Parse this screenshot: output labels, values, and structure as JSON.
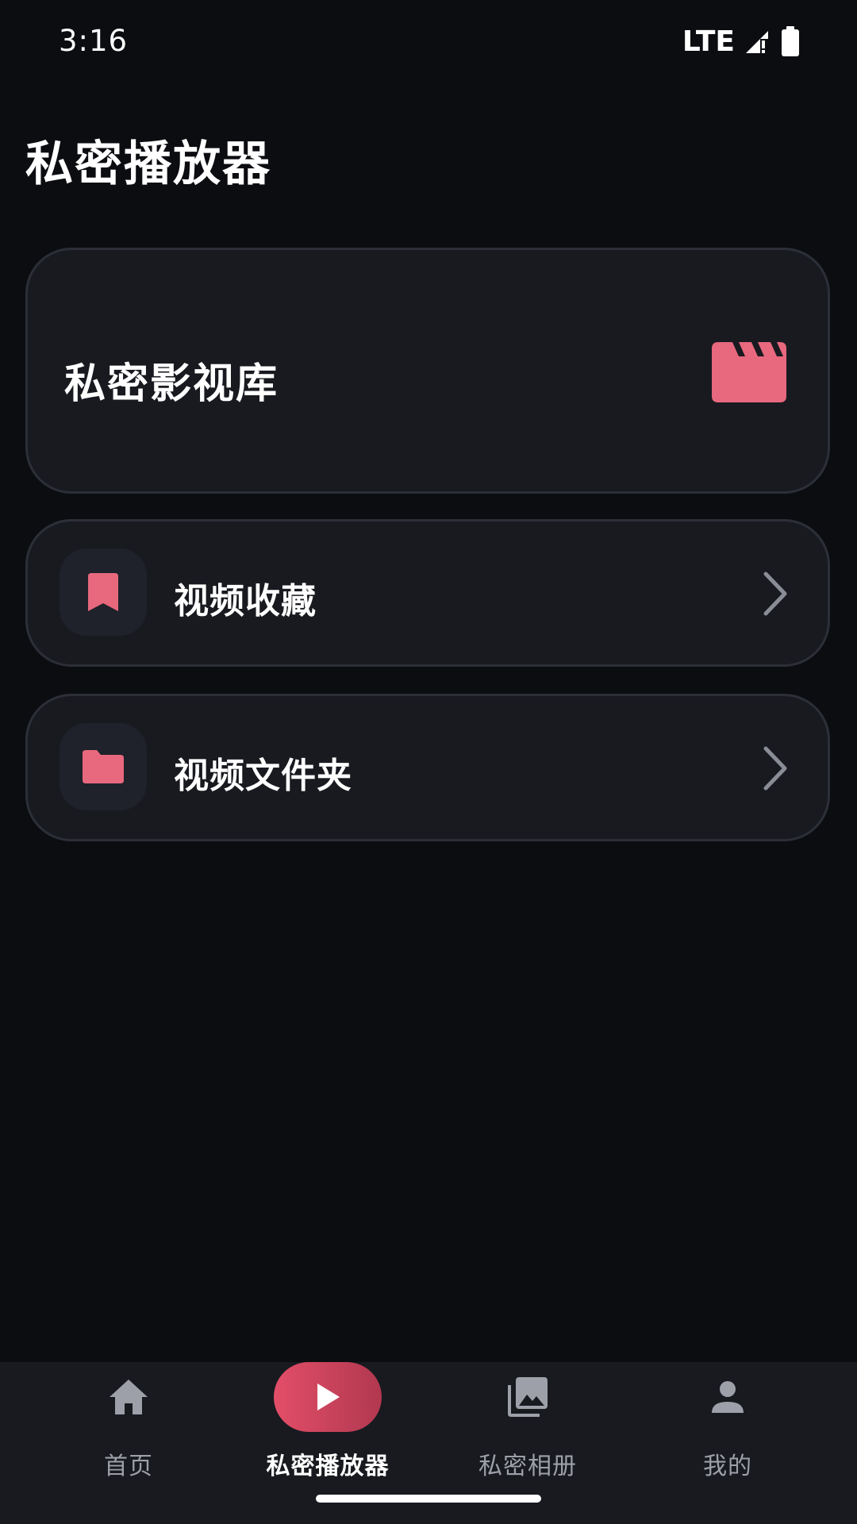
{
  "status_bar": {
    "time": "3:16",
    "network": "LTE",
    "icons": [
      "signal-icon",
      "battery-icon"
    ]
  },
  "page": {
    "title": "私密播放器"
  },
  "library_card": {
    "label": "私密影视库",
    "icon": "clapperboard-icon"
  },
  "menu": [
    {
      "label": "视频收藏",
      "icon": "bookmark-icon"
    },
    {
      "label": "视频文件夹",
      "icon": "folder-icon"
    }
  ],
  "bottom_nav": {
    "items": [
      {
        "label": "首页",
        "icon": "home-icon",
        "active": false
      },
      {
        "label": "私密播放器",
        "icon": "play-icon",
        "active": true
      },
      {
        "label": "私密相册",
        "icon": "photo-album-icon",
        "active": false
      },
      {
        "label": "我的",
        "icon": "person-icon",
        "active": false
      }
    ]
  },
  "colors": {
    "background": "#0c0d11",
    "card": "#181a20",
    "accent": "#e8687e",
    "nav_active": "#d4455f",
    "text_muted": "#9da0a8"
  }
}
